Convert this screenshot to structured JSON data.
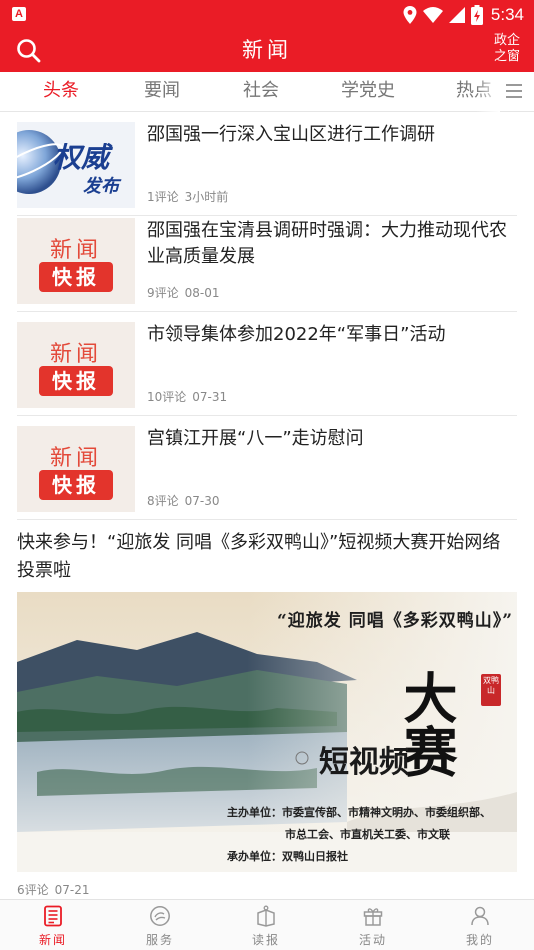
{
  "status_bar": {
    "time": "5:34",
    "app_icon_letter": "A",
    "battery_glyph": "⚡"
  },
  "header": {
    "title": "新闻",
    "right_button_line1": "政企",
    "right_button_line2": "之窗",
    "accent_color": "#ea1c26"
  },
  "tabs": [
    {
      "label": "头条",
      "active": true
    },
    {
      "label": "要闻",
      "active": false
    },
    {
      "label": "社会",
      "active": false
    },
    {
      "label": "学党史",
      "active": false
    },
    {
      "label": "热点",
      "active": false
    }
  ],
  "news": [
    {
      "title": "邵国强一行深入宝山区进行工作调研",
      "comments": "1评论",
      "time": "3小时前",
      "thumb": "quanwei",
      "thumb_line1": "权威",
      "thumb_line2": "发布"
    },
    {
      "title": "邵国强在宝清县调研时强调：大力推动现代农业高质量发展",
      "comments": "9评论",
      "time": "08-01",
      "thumb": "kuaibao",
      "thumb_line1": "新闻",
      "thumb_line2": "快报"
    },
    {
      "title": "市领导集体参加2022年“军事日”活动",
      "comments": "10评论",
      "time": "07-31",
      "thumb": "kuaibao",
      "thumb_line1": "新闻",
      "thumb_line2": "快报"
    },
    {
      "title": "宫镇江开展“八一”走访慰问",
      "comments": "8评论",
      "time": "07-30",
      "thumb": "kuaibao",
      "thumb_line1": "新闻",
      "thumb_line2": "快报"
    }
  ],
  "feature": {
    "title": "快来参与！“迎旅发 同唱《多彩双鸭山》”短视频大赛开始网络投票啦",
    "comments": "6评论",
    "time": "07-21",
    "banner": {
      "slogan": "“迎旅发  同唱《多彩双鸭山》”",
      "big_char": "大赛",
      "script": "短视频",
      "seal": "双鸭山",
      "organizers_line1": "主办单位：市委宣传部、市精神文明办、市委组织部、",
      "organizers_line2": "市总工会、市直机关工委、市文联",
      "organizers_line3": "承办单位：双鸭山日报社"
    }
  },
  "bottom_nav": [
    {
      "label": "新闻",
      "icon": "news-icon",
      "active": true
    },
    {
      "label": "服务",
      "icon": "service-icon",
      "active": false
    },
    {
      "label": "读报",
      "icon": "newspaper-icon",
      "active": false
    },
    {
      "label": "活动",
      "icon": "gift-icon",
      "active": false
    },
    {
      "label": "我的",
      "icon": "user-icon",
      "active": false
    }
  ]
}
